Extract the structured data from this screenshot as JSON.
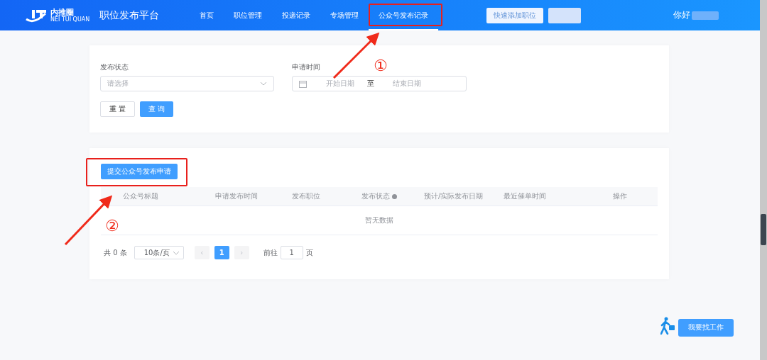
{
  "header": {
    "logo_text": "内推圈",
    "logo_sub": "NEI TUI QUAN",
    "title": "职位发布平台",
    "nav": [
      {
        "label": "首页",
        "selected": false
      },
      {
        "label": "职位管理",
        "selected": false
      },
      {
        "label": "投递记录",
        "selected": false
      },
      {
        "label": "专场管理",
        "selected": false
      },
      {
        "label": "公众号发布记录",
        "selected": true
      }
    ],
    "quick_button": "快速添加职位",
    "greeting": "你好"
  },
  "filters": {
    "status": {
      "label": "发布状态",
      "placeholder": "请选择"
    },
    "date": {
      "label": "申请时间",
      "start_placeholder": "开始日期",
      "separator": "至",
      "end_placeholder": "结束日期"
    },
    "buttons": [
      {
        "label": "重 置",
        "kind": "plain"
      },
      {
        "label": "查 询",
        "kind": "primary"
      }
    ]
  },
  "list": {
    "submit_button": "提交公众号发布申请",
    "columns": [
      {
        "label": "公众号标题"
      },
      {
        "label": "申请发布时间"
      },
      {
        "label": "发布职位"
      },
      {
        "label": "发布状态",
        "help": true
      },
      {
        "label": "预计/实际发布日期"
      },
      {
        "label": "最近催单时间"
      },
      {
        "label": "操作"
      }
    ],
    "empty_text": "暂无数据",
    "pagination": {
      "total": "共 0 条",
      "page_size": "10条/页",
      "prev": "‹",
      "pages": [
        {
          "label": "1",
          "selected": true
        }
      ],
      "next": "›",
      "goto_label": "前往",
      "goto_value": "1",
      "goto_suffix": "页"
    }
  },
  "float_button": "我要找工作",
  "annotations": [
    {
      "label": "①"
    },
    {
      "label": "②"
    }
  ]
}
